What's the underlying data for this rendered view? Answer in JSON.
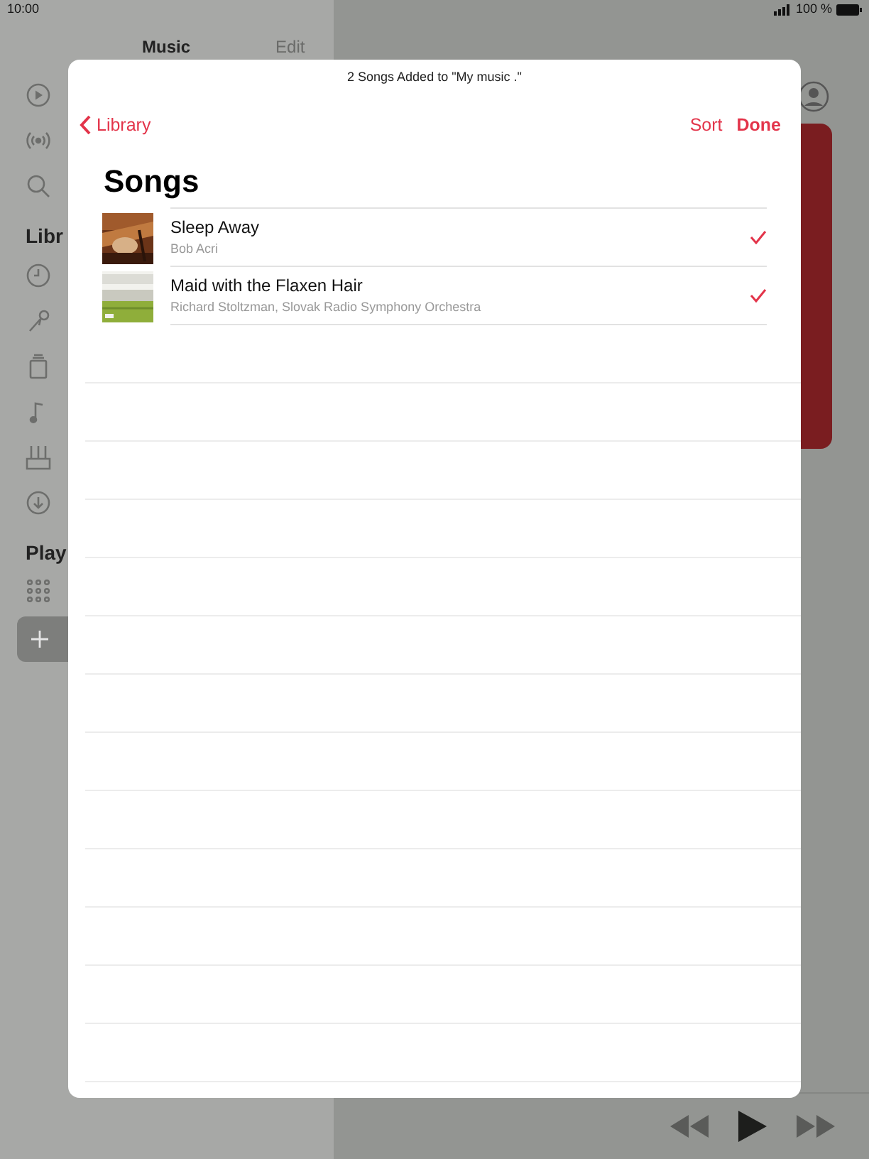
{
  "status_bar": {
    "time": "10:00",
    "battery": "100 %"
  },
  "sidebar": {
    "title": "Music",
    "edit": "Edit",
    "sections": [
      "Libr",
      "Play"
    ]
  },
  "sheet": {
    "banner": "2 Songs Added to \"My music .\"",
    "back": "Library",
    "sort": "Sort",
    "done": "Done",
    "title": "Songs",
    "songs": [
      {
        "title": "Sleep Away",
        "artist": "Bob Acri",
        "checked": true
      },
      {
        "title": "Maid with the Flaxen Hair",
        "artist": "Richard Stoltzman, Slovak Radio Symphony Orchestra",
        "checked": true
      }
    ]
  }
}
